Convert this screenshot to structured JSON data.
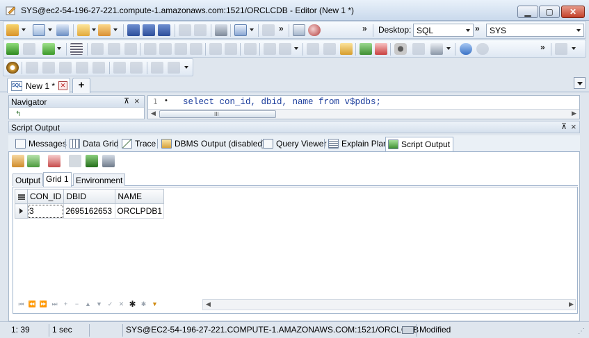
{
  "window": {
    "title": "SYS@ec2-54-196-27-221.compute-1.amazonaws.com:1521/ORCLCDB - Editor (New 1 *)",
    "minimize_icon": "minimize-icon",
    "maximize_icon": "maximize-icon",
    "close_icon": "close-icon"
  },
  "toolbar": {
    "desktop_label": "Desktop:",
    "desktop_value": "SQL",
    "connection_value": "SYS",
    "more_glyph": "»"
  },
  "editor_tabs": {
    "tab_label": "New 1 *",
    "add_tab": "+"
  },
  "navigator": {
    "title": "Navigator",
    "pin": "⊼",
    "close": "×"
  },
  "editor": {
    "line_number": "1",
    "code": "select con_id, dbid, name from v$pdbs;",
    "scroll_grip": "III"
  },
  "output_panel": {
    "title": "Script Output",
    "tabs": [
      {
        "label": "Messages"
      },
      {
        "label": "Data Grid"
      },
      {
        "label": "Trace"
      },
      {
        "label": "DBMS Output (disabled)"
      },
      {
        "label": "Query Viewer"
      },
      {
        "label": "Explain Plan"
      },
      {
        "label": "Script Output"
      }
    ],
    "subtabs": [
      {
        "label": "Output"
      },
      {
        "label": "Grid 1"
      },
      {
        "label": "Environment"
      }
    ]
  },
  "grid": {
    "columns": [
      "CON_ID",
      "DBID",
      "NAME"
    ],
    "rows": [
      [
        "3",
        "2695162653",
        "ORCLPDB1"
      ]
    ]
  },
  "statusbar": {
    "cursor_position": "1: 39",
    "elapsed": "1 sec",
    "connection": "SYS@EC2-54-196-27-221.COMPUTE-1.AMAZONAWS.COM:1521/ORCLCDB",
    "state": "Modified"
  }
}
